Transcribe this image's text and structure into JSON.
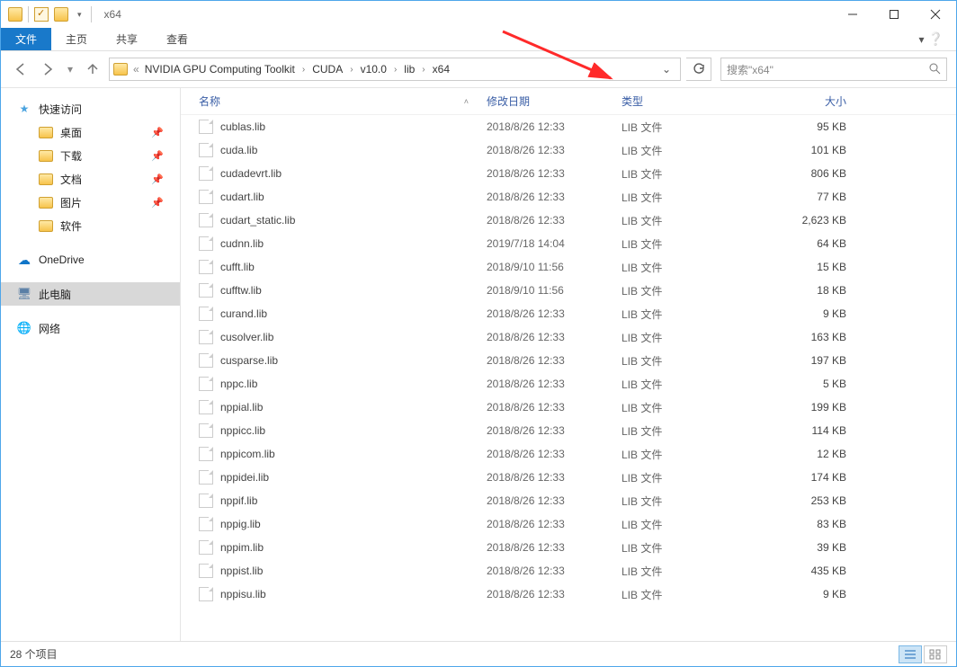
{
  "window": {
    "title": "x64"
  },
  "ribbon": {
    "file": "文件",
    "tabs": [
      "主页",
      "共享",
      "查看"
    ]
  },
  "breadcrumbs": [
    "NVIDIA GPU Computing Toolkit",
    "CUDA",
    "v10.0",
    "lib",
    "x64"
  ],
  "search": {
    "placeholder": "搜索\"x64\""
  },
  "sidebar": {
    "quick_access": "快速访问",
    "pinned": [
      "桌面",
      "下载",
      "文档",
      "图片"
    ],
    "software": "软件",
    "onedrive": "OneDrive",
    "this_pc": "此电脑",
    "network": "网络"
  },
  "columns": {
    "name": "名称",
    "date": "修改日期",
    "type": "类型",
    "size": "大小"
  },
  "files": [
    {
      "name": "cublas.lib",
      "date": "2018/8/26 12:33",
      "type": "LIB 文件",
      "size": "95 KB"
    },
    {
      "name": "cuda.lib",
      "date": "2018/8/26 12:33",
      "type": "LIB 文件",
      "size": "101 KB"
    },
    {
      "name": "cudadevrt.lib",
      "date": "2018/8/26 12:33",
      "type": "LIB 文件",
      "size": "806 KB"
    },
    {
      "name": "cudart.lib",
      "date": "2018/8/26 12:33",
      "type": "LIB 文件",
      "size": "77 KB"
    },
    {
      "name": "cudart_static.lib",
      "date": "2018/8/26 12:33",
      "type": "LIB 文件",
      "size": "2,623 KB"
    },
    {
      "name": "cudnn.lib",
      "date": "2019/7/18 14:04",
      "type": "LIB 文件",
      "size": "64 KB"
    },
    {
      "name": "cufft.lib",
      "date": "2018/9/10 11:56",
      "type": "LIB 文件",
      "size": "15 KB"
    },
    {
      "name": "cufftw.lib",
      "date": "2018/9/10 11:56",
      "type": "LIB 文件",
      "size": "18 KB"
    },
    {
      "name": "curand.lib",
      "date": "2018/8/26 12:33",
      "type": "LIB 文件",
      "size": "9 KB"
    },
    {
      "name": "cusolver.lib",
      "date": "2018/8/26 12:33",
      "type": "LIB 文件",
      "size": "163 KB"
    },
    {
      "name": "cusparse.lib",
      "date": "2018/8/26 12:33",
      "type": "LIB 文件",
      "size": "197 KB"
    },
    {
      "name": "nppc.lib",
      "date": "2018/8/26 12:33",
      "type": "LIB 文件",
      "size": "5 KB"
    },
    {
      "name": "nppial.lib",
      "date": "2018/8/26 12:33",
      "type": "LIB 文件",
      "size": "199 KB"
    },
    {
      "name": "nppicc.lib",
      "date": "2018/8/26 12:33",
      "type": "LIB 文件",
      "size": "114 KB"
    },
    {
      "name": "nppicom.lib",
      "date": "2018/8/26 12:33",
      "type": "LIB 文件",
      "size": "12 KB"
    },
    {
      "name": "nppidei.lib",
      "date": "2018/8/26 12:33",
      "type": "LIB 文件",
      "size": "174 KB"
    },
    {
      "name": "nppif.lib",
      "date": "2018/8/26 12:33",
      "type": "LIB 文件",
      "size": "253 KB"
    },
    {
      "name": "nppig.lib",
      "date": "2018/8/26 12:33",
      "type": "LIB 文件",
      "size": "83 KB"
    },
    {
      "name": "nppim.lib",
      "date": "2018/8/26 12:33",
      "type": "LIB 文件",
      "size": "39 KB"
    },
    {
      "name": "nppist.lib",
      "date": "2018/8/26 12:33",
      "type": "LIB 文件",
      "size": "435 KB"
    },
    {
      "name": "nppisu.lib",
      "date": "2018/8/26 12:33",
      "type": "LIB 文件",
      "size": "9 KB"
    }
  ],
  "status": {
    "count_label": "28 个项目"
  }
}
